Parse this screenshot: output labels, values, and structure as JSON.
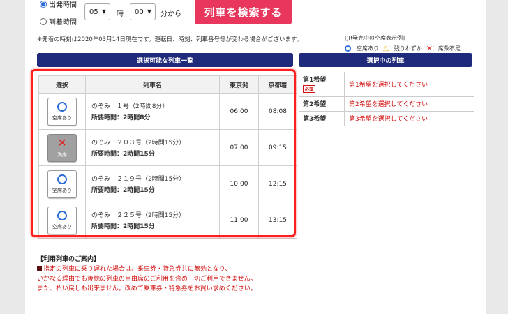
{
  "search": {
    "radio_depart": "出発時間",
    "radio_arrive": "到着時間",
    "hour_value": "05",
    "hour_unit": "時",
    "minute_value": "00",
    "minute_unit": "分から",
    "button": "列車を検索する"
  },
  "note": "※発着の時刻は2020年03月14日現在です。運転日、時刻、列車番号等が変わる場合がございます。",
  "legend": {
    "title": "[JR発売中の空席表示例]",
    "available": "：空席あり",
    "few": "：残りわずか",
    "none": "：席数不足"
  },
  "list_header": "選択可能な列車一覧",
  "selected_header": "選択中の列車",
  "table": {
    "col_select": "選択",
    "col_name": "列車名",
    "col_depart": "東京発",
    "col_arrive": "京都着",
    "rows": [
      {
        "seat": "空席あり",
        "name": "のぞみ　１号（2時間8分）",
        "duration": "所要時間：2時間8分",
        "depart": "06:00",
        "arrive": "08:08"
      },
      {
        "seat": "満席",
        "name": "のぞみ　２０３号（2時間15分）",
        "duration": "所要時間：2時間15分",
        "depart": "07:00",
        "arrive": "09:15"
      },
      {
        "seat": "空席あり",
        "name": "のぞみ　２１９号（2時間15分）",
        "duration": "所要時間：2時間15分",
        "depart": "10:00",
        "arrive": "12:15"
      },
      {
        "seat": "空席あり",
        "name": "のぞみ　２２５号（2時間15分）",
        "duration": "所要時間：2時間15分",
        "depart": "11:00",
        "arrive": "13:15"
      }
    ]
  },
  "prefs": [
    {
      "key": "第1希望",
      "badge": "必須",
      "value": "第1希望を選択してください"
    },
    {
      "key": "第2希望",
      "value": "第2希望を選択してください"
    },
    {
      "key": "第3希望",
      "value": "第3希望を選択してください"
    }
  ],
  "notice": {
    "title": "【利用列車のご案内】",
    "line1": "指定の列車に乗り遅れた場合は、乗車券・特急券共に無効となり、",
    "line2": "いかなる理由でも後続の列車の自由席のご利用を含め一切ご利用できません。",
    "line3": "また、払い戻しも出来ません。改めて乗車券・特急券をお買い求めください。"
  },
  "colors": {
    "accent": "#e8365d",
    "header": "#1f2a7a",
    "highlight": "#ff1f1f",
    "warning_text": "#d21010"
  }
}
